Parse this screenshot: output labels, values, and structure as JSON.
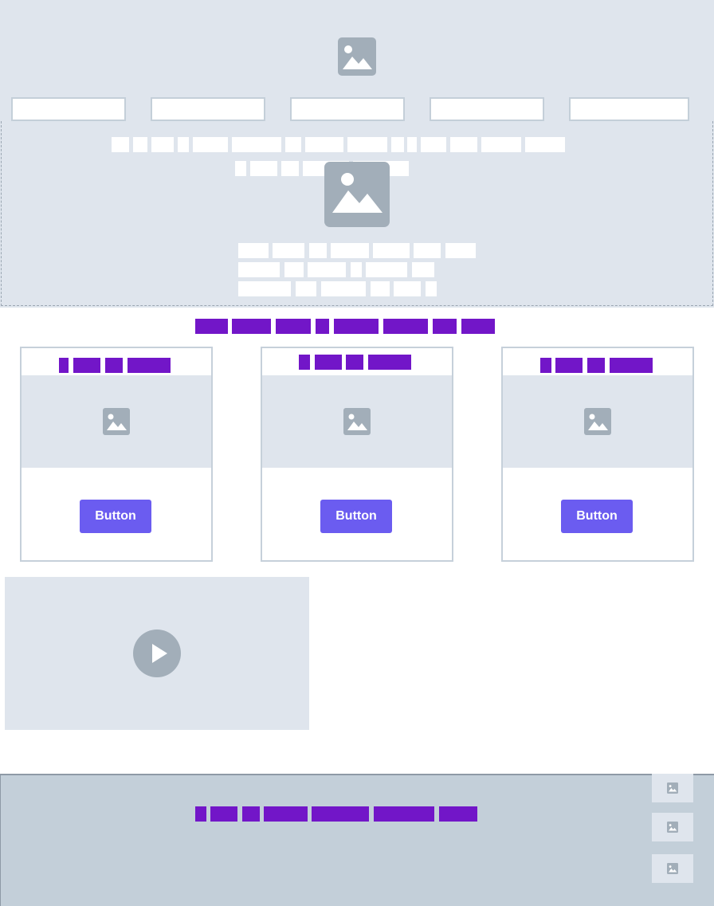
{
  "hero": {
    "image_icon": "image-placeholder-icon",
    "nav_items": 5
  },
  "features": {
    "cards": [
      {
        "button_label": "Button",
        "image_icon": "image-placeholder-icon"
      },
      {
        "button_label": "Button",
        "image_icon": "image-placeholder-icon"
      },
      {
        "button_label": "Button",
        "image_icon": "image-placeholder-icon"
      }
    ]
  },
  "video": {
    "play_icon": "play-icon"
  },
  "footer": {
    "thumbnail_icon": "image-placeholder-icon"
  },
  "colors": {
    "placeholder_bg": "#dfe5ed",
    "accent_text_bar": "#7216c8",
    "button": "#6b5cf0",
    "footer_bg": "#c3cfd9",
    "icon_gray": "#a2aeb9"
  }
}
